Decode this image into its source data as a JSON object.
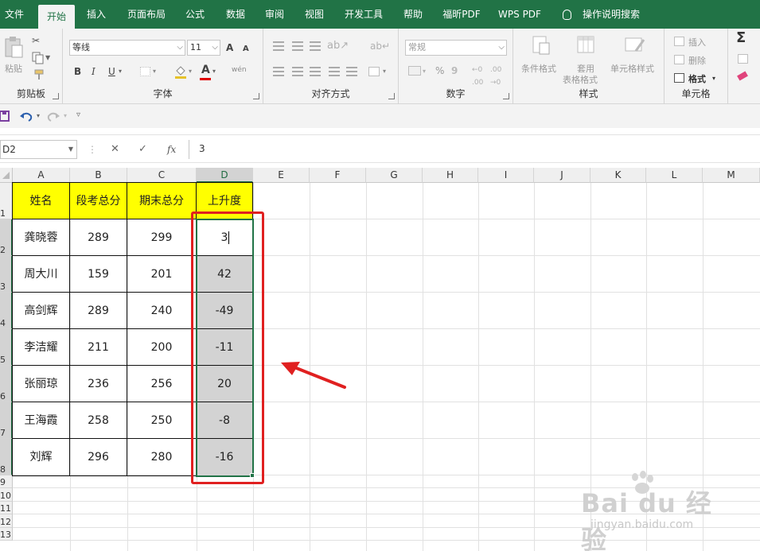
{
  "tabs": [
    {
      "label": "文件"
    },
    {
      "label": "开始"
    },
    {
      "label": "插入"
    },
    {
      "label": "页面布局"
    },
    {
      "label": "公式"
    },
    {
      "label": "数据"
    },
    {
      "label": "审阅"
    },
    {
      "label": "视图"
    },
    {
      "label": "开发工具"
    },
    {
      "label": "帮助"
    },
    {
      "label": "福昕PDF"
    },
    {
      "label": "WPS PDF"
    },
    {
      "label": "操作说明搜索"
    }
  ],
  "ribbon": {
    "clipboard": {
      "paste": "粘贴",
      "label": "剪贴板"
    },
    "font": {
      "name": "等线",
      "size": "11",
      "bold": "B",
      "italic": "I",
      "underline": "U",
      "grow": "A",
      "shrink": "A",
      "font_color": "A",
      "phonetic": "wén",
      "label": "字体"
    },
    "alignment": {
      "label": "对齐方式"
    },
    "number": {
      "format": "常规",
      "percent": "%",
      "comma": "9",
      "label": "数字"
    },
    "styles": {
      "conditional": "条件格式",
      "table_1": "套用",
      "table_2": "表格格式",
      "cell_styles": "单元格样式",
      "label": "样式"
    },
    "cells": {
      "insert": "插入",
      "delete": "删除",
      "format": "格式",
      "label": "单元格"
    },
    "editing": {
      "sum": "Σ"
    }
  },
  "qat": {
    "save": "",
    "undo": "",
    "redo": ""
  },
  "formula_bar": {
    "name_box": "D2",
    "fx": "fx",
    "value": "3",
    "cancel": "✕",
    "enter": "✓"
  },
  "sheet": {
    "columns": [
      "A",
      "B",
      "C",
      "D",
      "E",
      "F",
      "G",
      "H",
      "I",
      "J",
      "K",
      "L",
      "M"
    ],
    "rows": [
      "1",
      "2",
      "3",
      "4",
      "5",
      "6",
      "7",
      "8",
      "9",
      "10",
      "11",
      "12",
      "13"
    ],
    "header": [
      "姓名",
      "段考总分",
      "期末总分",
      "上升度"
    ],
    "data": [
      [
        "龚晓蓉",
        "289",
        "299",
        "3"
      ],
      [
        "周大川",
        "159",
        "201",
        "42"
      ],
      [
        "高剑辉",
        "289",
        "240",
        "-49"
      ],
      [
        "李洁耀",
        "211",
        "200",
        "-11"
      ],
      [
        "张丽琼",
        "236",
        "256",
        "20"
      ],
      [
        "王海霞",
        "258",
        "250",
        "-8"
      ],
      [
        "刘辉",
        "296",
        "280",
        "-16"
      ]
    ]
  },
  "watermark": {
    "logo": "Bai du 经验",
    "url": "jingyan.baidu.com"
  },
  "colors": {
    "accent": "#217346",
    "header_fill": "#ffff00",
    "highlight": "#e02020",
    "selection": "#d3d3d3"
  }
}
